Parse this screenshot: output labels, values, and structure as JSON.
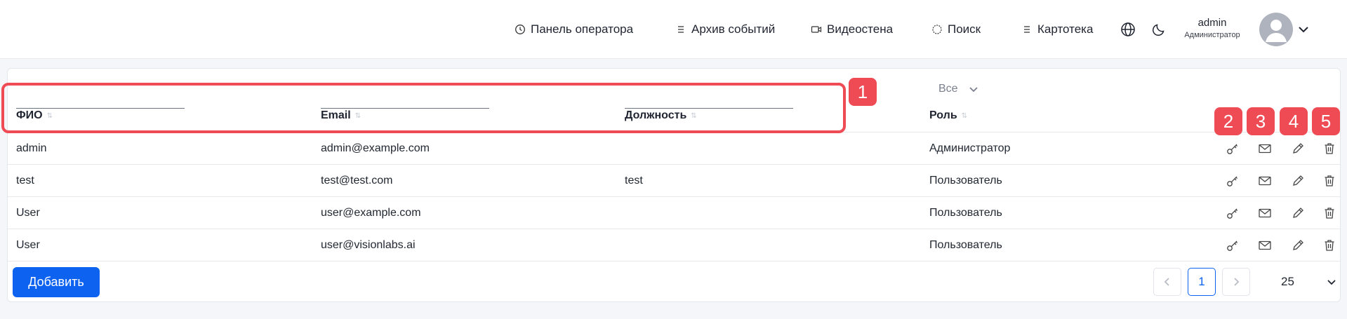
{
  "header": {
    "nav": [
      {
        "label": "Панель оператора",
        "icon": "clock-icon"
      },
      {
        "label": "Архив событий",
        "icon": "list-icon"
      },
      {
        "label": "Видеостена",
        "icon": "video-icon"
      },
      {
        "label": "Поиск",
        "icon": "search-icon"
      },
      {
        "label": "Картотека",
        "icon": "list-icon"
      }
    ],
    "user": {
      "name": "admin",
      "role": "Администратор"
    }
  },
  "table": {
    "columns": [
      "ФИО",
      "Email",
      "Должность",
      "Роль"
    ],
    "role_filter": "Все",
    "rows": [
      {
        "name": "admin",
        "email": "admin@example.com",
        "position": "",
        "role": "Администратор"
      },
      {
        "name": "test",
        "email": "test@test.com",
        "position": "test",
        "role": "Пользователь"
      },
      {
        "name": "User",
        "email": "user@example.com",
        "position": "",
        "role": "Пользователь"
      },
      {
        "name": "User",
        "email": "user@visionlabs.ai",
        "position": "",
        "role": "Пользователь"
      }
    ],
    "actions": [
      "key-icon",
      "mail-icon",
      "edit-icon",
      "trash-icon"
    ]
  },
  "footer": {
    "add_label": "Добавить",
    "page": "1",
    "page_size": "25"
  },
  "annotations": [
    "1",
    "2",
    "3",
    "4",
    "5"
  ],
  "colors": {
    "accent": "#0d62f0",
    "annotation": "#ef4b55"
  }
}
